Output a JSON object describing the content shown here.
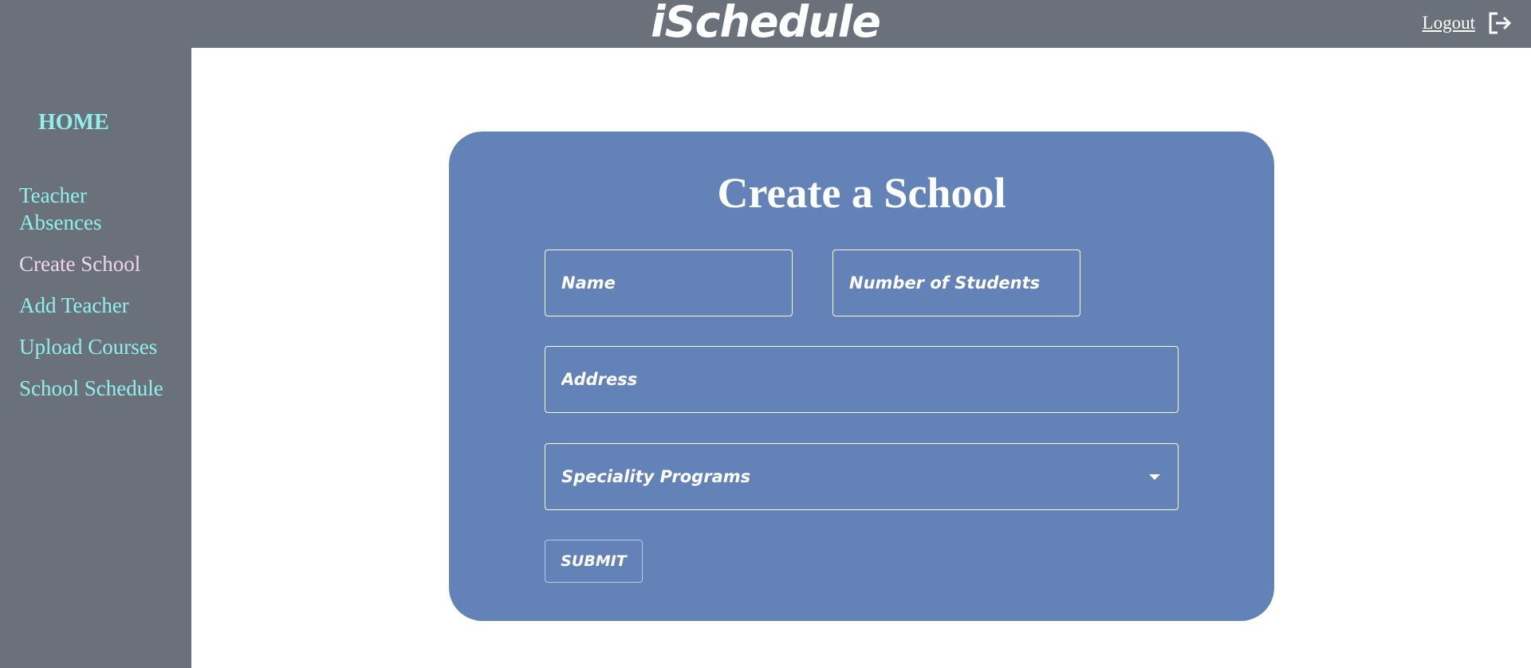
{
  "header": {
    "app_title": "iSchedule",
    "logout_label": "Logout",
    "logout_icon": "logout-icon"
  },
  "sidebar": {
    "home_label": "HOME",
    "items": [
      {
        "label": "Teacher Absences",
        "active": false
      },
      {
        "label": "Create School",
        "active": true
      },
      {
        "label": "Add Teacher",
        "active": false
      },
      {
        "label": "Upload Courses",
        "active": false
      },
      {
        "label": "School Schedule",
        "active": false
      }
    ]
  },
  "form": {
    "title": "Create a School",
    "name_placeholder": "Name",
    "name_value": "",
    "students_placeholder": "Number of Students",
    "students_value": "",
    "address_placeholder": "Address",
    "address_value": "",
    "programs_label": "Speciality Programs",
    "programs_icon": "chevron-down-icon",
    "submit_label": "SUBMIT"
  },
  "colors": {
    "header_bg": "#6b717b",
    "sidebar_bg": "#6b717b",
    "card_bg": "#6282b8",
    "nav_link": "#8ff0ec",
    "nav_active": "#efd6ee"
  }
}
